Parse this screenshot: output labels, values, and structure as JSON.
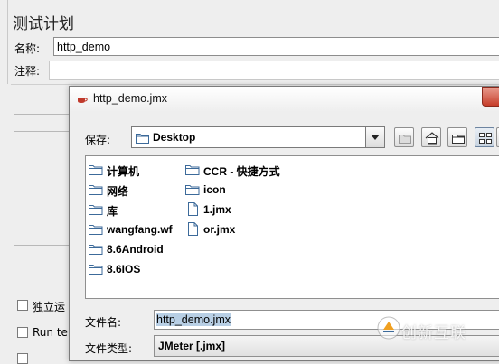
{
  "background": {
    "title": "测试计划",
    "name_label": "名称:",
    "name_value": "http_demo",
    "comment_label": "注释:",
    "checkboxes": [
      {
        "label": "独立运"
      },
      {
        "label": "Run te"
      }
    ]
  },
  "dialog": {
    "title": "http_demo.jmx",
    "save_in_label": "保存:",
    "location_value": "Desktop",
    "toolbar_icons": [
      "up-folder-icon",
      "home-icon",
      "new-folder-icon",
      "list-view-icon"
    ],
    "files": [
      {
        "name": "计算机",
        "type": "folder"
      },
      {
        "name": "网络",
        "type": "folder"
      },
      {
        "name": "库",
        "type": "folder"
      },
      {
        "name": "wangfang.wf",
        "type": "folder"
      },
      {
        "name": "8.6Android",
        "type": "folder"
      },
      {
        "name": "8.6IOS",
        "type": "folder"
      },
      {
        "name": "CCR - 快捷方式",
        "type": "folder"
      },
      {
        "name": "icon",
        "type": "folder"
      },
      {
        "name": "1.jmx",
        "type": "file"
      },
      {
        "name": "or.jmx",
        "type": "file"
      }
    ],
    "filename_label": "文件名:",
    "filename_value": "http_demo.jmx",
    "filetype_label": "文件类型:",
    "filetype_value": "JMeter [.jmx]"
  },
  "watermark": {
    "text": "创新互联"
  },
  "colors": {
    "window_bg": "#eeeeee",
    "selection": "#b8cfe5",
    "folder_icon": "#3c6a9a",
    "close_button": "#c63d2a"
  }
}
